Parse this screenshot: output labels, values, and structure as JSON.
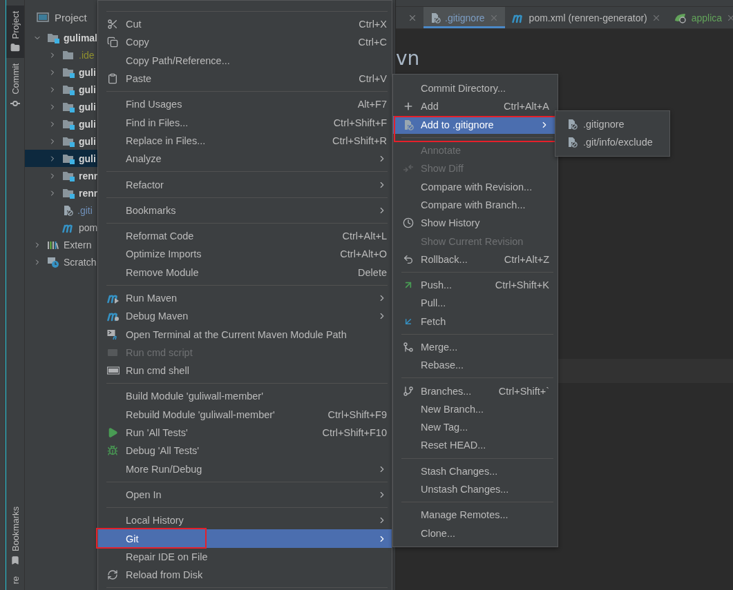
{
  "tool_strip": {
    "top": [
      {
        "label": "Project",
        "selected": true
      },
      {
        "label": "Commit",
        "selected": false
      }
    ],
    "bottom": [
      {
        "label": "Bookmarks",
        "selected": false
      },
      {
        "label": "re",
        "selected": false
      }
    ]
  },
  "project_panel": {
    "title": "Project",
    "tree": [
      {
        "label": "gulimal",
        "kind": "module",
        "color": "#d4d4d4",
        "expanded": true,
        "selected": false,
        "children": [
          {
            "label": ".ide",
            "kind": "folder",
            "color": "#8f8f2e",
            "expanded": false,
            "selected": false
          },
          {
            "label": "guli",
            "kind": "module",
            "color": "#d4d4d4",
            "expanded": false,
            "selected": false
          },
          {
            "label": "guli",
            "kind": "module",
            "color": "#d4d4d4",
            "expanded": false,
            "selected": false
          },
          {
            "label": "guli",
            "kind": "module",
            "color": "#d4d4d4",
            "expanded": false,
            "selected": false
          },
          {
            "label": "guli",
            "kind": "module",
            "color": "#d4d4d4",
            "expanded": false,
            "selected": false
          },
          {
            "label": "guli",
            "kind": "module",
            "color": "#d4d4d4",
            "expanded": false,
            "selected": false
          },
          {
            "label": "guli",
            "kind": "module",
            "color": "#d4d4d4",
            "expanded": false,
            "selected": true
          },
          {
            "label": "renr",
            "kind": "module",
            "color": "#d4d4d4",
            "expanded": false,
            "selected": false
          },
          {
            "label": "renr",
            "kind": "module",
            "color": "#d4d4d4",
            "expanded": false,
            "selected": false
          },
          {
            "label": ".giti",
            "kind": "ignored-file",
            "color": "#6f8fb8",
            "selected": false
          },
          {
            "label": "pom",
            "kind": "maven-file",
            "color": "#bbbbbb",
            "selected": false
          }
        ]
      },
      {
        "label": "Extern",
        "kind": "libraries",
        "color": "#bbbbbb",
        "expanded": false,
        "selected": false
      },
      {
        "label": "Scratch",
        "kind": "scratches",
        "color": "#bbbbbb",
        "expanded": false,
        "selected": false
      }
    ]
  },
  "editor": {
    "tabs": [
      {
        "label": ".gitignore",
        "color": "#7d9ec4",
        "selected": true
      },
      {
        "label": "pom.xml (renren-generator)",
        "color": "#bbbbbb",
        "selected": false
      },
      {
        "label": "applica",
        "color": "#62a35a",
        "selected": false
      }
    ],
    "text": "vn"
  },
  "context_menu": {
    "groups": [
      {
        "items": [
          {
            "label": "Cut",
            "shortcut": "Ctrl+X",
            "submenu": false,
            "disabled": false,
            "selected": false,
            "framed": false
          },
          {
            "label": "Copy",
            "shortcut": "Ctrl+C",
            "submenu": false,
            "disabled": false,
            "selected": false,
            "framed": false
          },
          {
            "label": "Copy Path/Reference...",
            "submenu": false,
            "disabled": false,
            "selected": false,
            "framed": false
          },
          {
            "label": "Paste",
            "shortcut": "Ctrl+V",
            "submenu": false,
            "disabled": false,
            "selected": false,
            "framed": false
          }
        ]
      },
      {
        "items": [
          {
            "label": "Find Usages",
            "shortcut": "Alt+F7",
            "submenu": false,
            "disabled": false,
            "selected": false,
            "framed": false
          },
          {
            "label": "Find in Files...",
            "shortcut": "Ctrl+Shift+F",
            "submenu": false,
            "disabled": false,
            "selected": false,
            "framed": false
          },
          {
            "label": "Replace in Files...",
            "shortcut": "Ctrl+Shift+R",
            "submenu": false,
            "disabled": false,
            "selected": false,
            "framed": false
          },
          {
            "label": "Analyze",
            "submenu": true,
            "disabled": false,
            "selected": false,
            "framed": false
          }
        ]
      },
      {
        "items": [
          {
            "label": "Refactor",
            "submenu": true,
            "disabled": false,
            "selected": false,
            "framed": false
          }
        ]
      },
      {
        "items": [
          {
            "label": "Bookmarks",
            "submenu": true,
            "disabled": false,
            "selected": false,
            "framed": false
          }
        ]
      },
      {
        "items": [
          {
            "label": "Reformat Code",
            "shortcut": "Ctrl+Alt+L",
            "submenu": false,
            "disabled": false,
            "selected": false,
            "framed": false
          },
          {
            "label": "Optimize Imports",
            "shortcut": "Ctrl+Alt+O",
            "submenu": false,
            "disabled": false,
            "selected": false,
            "framed": false
          },
          {
            "label": "Remove Module",
            "shortcut": "Delete",
            "submenu": false,
            "disabled": false,
            "selected": false,
            "framed": false
          }
        ]
      },
      {
        "items": [
          {
            "label": "Run Maven",
            "submenu": true,
            "disabled": false,
            "selected": false,
            "framed": false
          },
          {
            "label": "Debug Maven",
            "submenu": true,
            "disabled": false,
            "selected": false,
            "framed": false
          },
          {
            "label": "Open Terminal at the Current Maven Module Path",
            "submenu": false,
            "disabled": false,
            "selected": false,
            "framed": false
          },
          {
            "label": "Run cmd script",
            "submenu": false,
            "disabled": true,
            "selected": false,
            "framed": false
          },
          {
            "label": "Run cmd shell",
            "submenu": false,
            "disabled": false,
            "selected": false,
            "framed": false
          }
        ]
      },
      {
        "items": [
          {
            "label": "Build Module 'guliwall-member'",
            "submenu": false,
            "disabled": false,
            "selected": false,
            "framed": false
          },
          {
            "label": "Rebuild Module 'guliwall-member'",
            "shortcut": "Ctrl+Shift+F9",
            "submenu": false,
            "disabled": false,
            "selected": false,
            "framed": false
          },
          {
            "label": "Run 'All Tests'",
            "shortcut": "Ctrl+Shift+F10",
            "submenu": false,
            "disabled": false,
            "selected": false,
            "framed": false
          },
          {
            "label": "Debug 'All Tests'",
            "submenu": false,
            "disabled": false,
            "selected": false,
            "framed": false
          },
          {
            "label": "More Run/Debug",
            "submenu": true,
            "disabled": false,
            "selected": false,
            "framed": false
          }
        ]
      },
      {
        "items": [
          {
            "label": "Open In",
            "submenu": true,
            "disabled": false,
            "selected": false,
            "framed": false
          }
        ]
      },
      {
        "items": [
          {
            "label": "Local History",
            "submenu": true,
            "disabled": false,
            "selected": false,
            "framed": false
          },
          {
            "label": "Git",
            "submenu": true,
            "disabled": false,
            "selected": true,
            "framed": true
          },
          {
            "label": "Repair IDE on File",
            "submenu": false,
            "disabled": false,
            "selected": false,
            "framed": false
          },
          {
            "label": "Reload from Disk",
            "submenu": false,
            "disabled": false,
            "selected": false,
            "framed": false
          }
        ]
      }
    ]
  },
  "git_menu": {
    "groups": [
      {
        "items": [
          {
            "label": "Commit Directory...",
            "submenu": false,
            "disabled": false,
            "selected": false,
            "framed": false
          },
          {
            "label": "Add",
            "shortcut": "Ctrl+Alt+A",
            "submenu": false,
            "disabled": false,
            "selected": false,
            "framed": false
          },
          {
            "label": "Add to .gitignore",
            "submenu": true,
            "disabled": false,
            "selected": true,
            "framed": true
          }
        ]
      },
      {
        "items": [
          {
            "label": "Annotate",
            "submenu": false,
            "disabled": true,
            "selected": false,
            "framed": false
          },
          {
            "label": "Show Diff",
            "submenu": false,
            "disabled": true,
            "selected": false,
            "framed": false
          },
          {
            "label": "Compare with Revision...",
            "submenu": false,
            "disabled": false,
            "selected": false,
            "framed": false
          },
          {
            "label": "Compare with Branch...",
            "submenu": false,
            "disabled": false,
            "selected": false,
            "framed": false
          },
          {
            "label": "Show History",
            "submenu": false,
            "disabled": false,
            "selected": false,
            "framed": false
          },
          {
            "label": "Show Current Revision",
            "submenu": false,
            "disabled": true,
            "selected": false,
            "framed": false
          },
          {
            "label": "Rollback...",
            "shortcut": "Ctrl+Alt+Z",
            "submenu": false,
            "disabled": false,
            "selected": false,
            "framed": false
          }
        ]
      },
      {
        "items": [
          {
            "label": "Push...",
            "shortcut": "Ctrl+Shift+K",
            "submenu": false,
            "disabled": false,
            "selected": false,
            "framed": false
          },
          {
            "label": "Pull...",
            "submenu": false,
            "disabled": false,
            "selected": false,
            "framed": false
          },
          {
            "label": "Fetch",
            "submenu": false,
            "disabled": false,
            "selected": false,
            "framed": false
          }
        ]
      },
      {
        "items": [
          {
            "label": "Merge...",
            "submenu": false,
            "disabled": false,
            "selected": false,
            "framed": false
          },
          {
            "label": "Rebase...",
            "submenu": false,
            "disabled": false,
            "selected": false,
            "framed": false
          }
        ]
      },
      {
        "items": [
          {
            "label": "Branches...",
            "shortcut": "Ctrl+Shift+`",
            "submenu": false,
            "disabled": false,
            "selected": false,
            "framed": false
          },
          {
            "label": "New Branch...",
            "submenu": false,
            "disabled": false,
            "selected": false,
            "framed": false
          },
          {
            "label": "New Tag...",
            "submenu": false,
            "disabled": false,
            "selected": false,
            "framed": false
          },
          {
            "label": "Reset HEAD...",
            "submenu": false,
            "disabled": false,
            "selected": false,
            "framed": false
          }
        ]
      },
      {
        "items": [
          {
            "label": "Stash Changes...",
            "submenu": false,
            "disabled": false,
            "selected": false,
            "framed": false
          },
          {
            "label": "Unstash Changes...",
            "submenu": false,
            "disabled": false,
            "selected": false,
            "framed": false
          }
        ]
      },
      {
        "items": [
          {
            "label": "Manage Remotes...",
            "submenu": false,
            "disabled": false,
            "selected": false,
            "framed": false
          },
          {
            "label": "Clone...",
            "submenu": false,
            "disabled": false,
            "selected": false,
            "framed": false
          }
        ]
      }
    ]
  },
  "gitignore_submenu": {
    "groups": [
      {
        "items": [
          {
            "label": ".gitignore",
            "submenu": false,
            "disabled": false,
            "selected": false,
            "framed": false
          },
          {
            "label": ".git/info/exclude",
            "submenu": false,
            "disabled": false,
            "selected": false,
            "framed": false
          }
        ]
      }
    ]
  }
}
